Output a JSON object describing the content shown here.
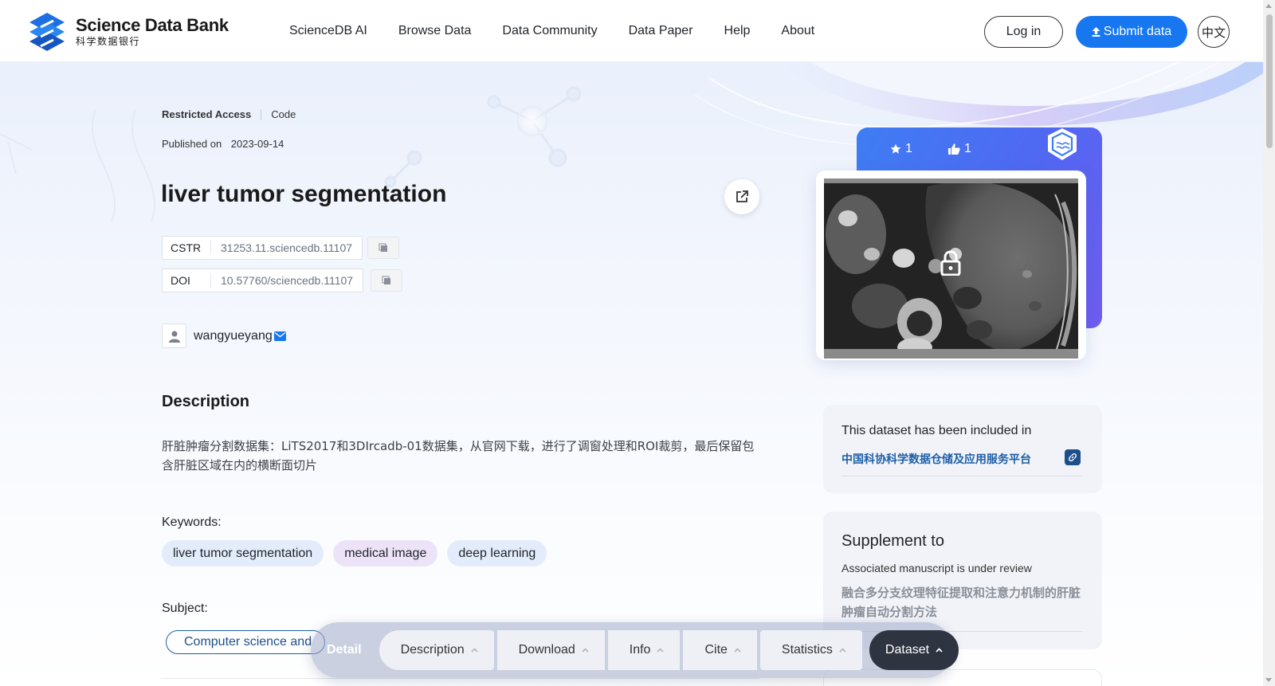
{
  "header": {
    "logo_title": "Science Data Bank",
    "logo_subtitle": "科学数据银行",
    "nav": [
      "ScienceDB AI",
      "Browse Data",
      "Data Community",
      "Data Paper",
      "Help",
      "About"
    ],
    "login_label": "Log in",
    "submit_label": "Submit data",
    "lang_label": "中文"
  },
  "dataset": {
    "access": "Restricted Access",
    "type": "Code",
    "published_label": "Published on",
    "published_date": "2023-09-14",
    "title": "liver tumor segmentation",
    "ids": [
      {
        "key": "CSTR",
        "value": "31253.11.sciencedb.11107"
      },
      {
        "key": "DOI",
        "value": "10.57760/sciencedb.11107"
      }
    ],
    "author": "wangyueyang",
    "description_heading": "Description",
    "description": "肝脏肿瘤分割数据集：LiTS2017和3DIrcadb-01数据集，从官网下载，进行了调窗处理和ROI裁剪，最后保留包含肝脏区域在内的横断面切片",
    "keywords_label": "Keywords:",
    "keywords": [
      "liver tumor segmentation",
      "medical image",
      "deep learning"
    ],
    "subject_label": "Subject:",
    "subject": "Computer science and"
  },
  "sidebar": {
    "stars": "1",
    "likes": "1",
    "included_text": "This dataset has been included in",
    "included_link": "中国科协科学数据仓储及应用服务平台",
    "supplement_title": "Supplement to",
    "supplement_status": "Associated manuscript is under review",
    "manuscript_title": "融合多分支纹理特征提取和注意力机制的肝脏肿瘤自动分割方法"
  },
  "floatbar": {
    "label": "Detail",
    "items": [
      "Description",
      "Download",
      "Info",
      "Cite",
      "Statistics"
    ],
    "active": "Dataset"
  },
  "colors": {
    "primary": "#1677f0",
    "card_gradient_start": "#3e7df3",
    "card_gradient_end": "#6f5cf0",
    "link": "#1e5fa8",
    "active_tab": "#2f3441"
  }
}
